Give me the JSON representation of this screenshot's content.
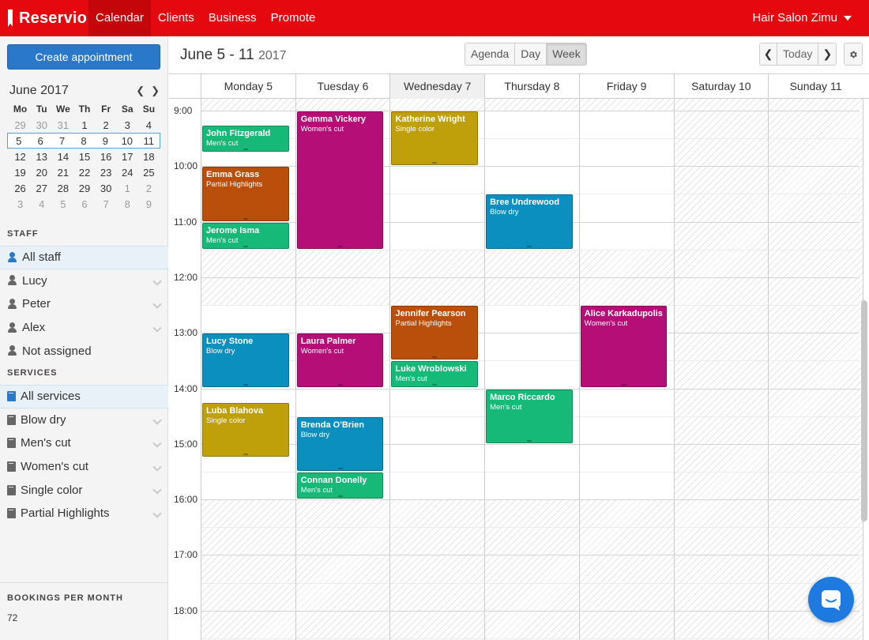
{
  "topbar": {
    "logo": "Reservio",
    "nav": [
      "Calendar",
      "Clients",
      "Business",
      "Promote"
    ],
    "salon": "Hair Salon Zimu"
  },
  "sidebar": {
    "create_label": "Create appointment",
    "mini_title": "June 2017",
    "weekdays": [
      "Mo",
      "Tu",
      "We",
      "Th",
      "Fr",
      "Sa",
      "Su"
    ],
    "weeks": [
      [
        "29",
        "30",
        "31",
        "1",
        "2",
        "3",
        "4"
      ],
      [
        "5",
        "6",
        "7",
        "8",
        "9",
        "10",
        "11"
      ],
      [
        "12",
        "13",
        "14",
        "15",
        "16",
        "17",
        "18"
      ],
      [
        "19",
        "20",
        "21",
        "22",
        "23",
        "24",
        "25"
      ],
      [
        "26",
        "27",
        "28",
        "29",
        "30",
        "1",
        "2"
      ],
      [
        "3",
        "4",
        "5",
        "6",
        "7",
        "8",
        "9"
      ]
    ],
    "staff_title": "STAFF",
    "staff": [
      "All staff",
      "Lucy",
      "Peter",
      "Alex",
      "Not assigned"
    ],
    "services_title": "SERVICES",
    "services": [
      "All services",
      "Blow dry",
      "Men's cut",
      "Women's cut",
      "Single color",
      "Partial Highlights"
    ],
    "bookings_title": "BOOKINGS PER MONTH",
    "bookings_value": "72"
  },
  "header": {
    "range": "June 5 - 11",
    "year": "2017",
    "views": [
      "Agenda",
      "Day",
      "Week"
    ],
    "active_view": "Week",
    "today_label": "Today"
  },
  "calendar": {
    "days": [
      "Monday 5",
      "Tuesday 6",
      "Wednesday 7",
      "Thursday 8",
      "Friday 9",
      "Saturday 10",
      "Sunday 11"
    ],
    "today_index": 2,
    "hours": [
      "9:00",
      "10:00",
      "11:00",
      "12:00",
      "13:00",
      "14:00",
      "15:00",
      "16:00",
      "17:00",
      "18:00"
    ],
    "appointments": [
      {
        "day": 0,
        "start": "9:15",
        "end": "9:45",
        "name": "John Fitzgerald",
        "service": "Men's cut",
        "color": "#17b978"
      },
      {
        "day": 0,
        "start": "10:00",
        "end": "11:00",
        "name": "Emma Grass",
        "service": "Partial Highlights",
        "color": "#b94f0b"
      },
      {
        "day": 0,
        "start": "11:00",
        "end": "11:30",
        "name": "Jerome Isma",
        "service": "Men's cut",
        "color": "#17b978"
      },
      {
        "day": 0,
        "start": "13:00",
        "end": "14:00",
        "name": "Lucy Stone",
        "service": "Blow dry",
        "color": "#0b8fbf"
      },
      {
        "day": 0,
        "start": "14:15",
        "end": "15:15",
        "name": "Luba Blahova",
        "service": "Single color",
        "color": "#bfa00b"
      },
      {
        "day": 1,
        "start": "9:00",
        "end": "11:30",
        "name": "Gemma Vickery",
        "service": "Women's cut",
        "color": "#b50f77"
      },
      {
        "day": 1,
        "start": "13:00",
        "end": "14:00",
        "name": "Laura Palmer",
        "service": "Women's cut",
        "color": "#b50f77"
      },
      {
        "day": 1,
        "start": "14:30",
        "end": "15:30",
        "name": "Brenda O'Brien",
        "service": "Blow dry",
        "color": "#0b8fbf"
      },
      {
        "day": 1,
        "start": "15:30",
        "end": "16:00",
        "name": "Connan Donelly",
        "service": "Men's cut",
        "color": "#17b978"
      },
      {
        "day": 2,
        "start": "9:00",
        "end": "10:00",
        "name": "Katherine Wright",
        "service": "Single color",
        "color": "#bfa00b"
      },
      {
        "day": 2,
        "start": "12:30",
        "end": "13:30",
        "name": "Jennifer Pearson",
        "service": "Partial Highlights",
        "color": "#b94f0b"
      },
      {
        "day": 2,
        "start": "13:30",
        "end": "14:00",
        "name": "Luke Wroblowski",
        "service": "Men's cut",
        "color": "#17b978"
      },
      {
        "day": 3,
        "start": "10:30",
        "end": "11:30",
        "name": "Bree Undrewood",
        "service": "Blow dry",
        "color": "#0b8fbf"
      },
      {
        "day": 3,
        "start": "14:00",
        "end": "15:00",
        "name": "Marco Riccardo",
        "service": "Men's cut",
        "color": "#17b978"
      },
      {
        "day": 4,
        "start": "12:30",
        "end": "14:00",
        "name": "Alice Karkadupolis",
        "service": "Women's cut",
        "color": "#b50f77"
      }
    ]
  }
}
